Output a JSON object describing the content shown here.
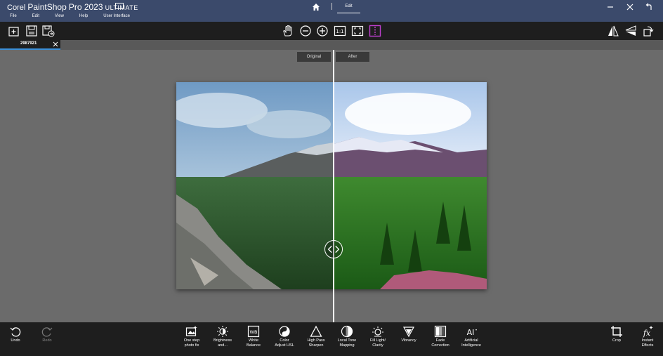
{
  "app": {
    "brand_corel": "Corel",
    "brand_product": "PaintShop",
    "brand_pro": "Pro 2023",
    "brand_edition": "ULTIMATE"
  },
  "menu": [
    "File",
    "Edit",
    "View",
    "Help",
    "User Interface"
  ],
  "nav": {
    "edit_tab": "Edit"
  },
  "document_tab": {
    "label": "2987921"
  },
  "compare": {
    "original_label": "Original",
    "after_label": "After"
  },
  "bottom_tools": {
    "undo": "Undo",
    "redo": "Redo",
    "one_step": "One step\nphoto fix",
    "brightness": "Brightness\nand...",
    "white_balance": "White\nBalance",
    "color_adjust": "Color\nAdjust HSL",
    "high_pass": "High Pass\nSharpen",
    "local_tone": "Local Tone\nMapping",
    "fill_light": "Fill Light/\nClarity",
    "vibrancy": "Vibrancy",
    "fade_correction": "Fade\nCorrection",
    "artificial_intelligence": "Artificial\nIntelligence",
    "crop": "Crop",
    "instant_effects": "Instant\nEffects"
  },
  "colors": {
    "title_bar": "#3b4a6b",
    "toolbar": "#1e1e1e",
    "canvas": "#6b6b6b",
    "tab_accent": "#3b8fd8",
    "active_tool": "#c040d0"
  }
}
